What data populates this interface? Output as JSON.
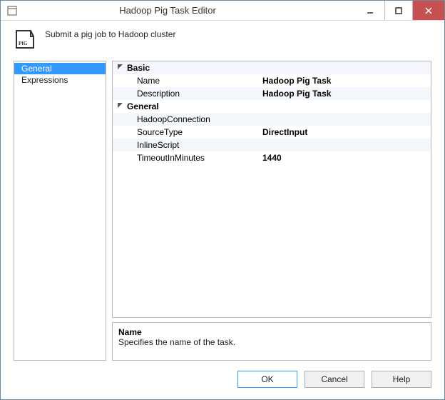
{
  "window": {
    "title": "Hadoop Pig Task Editor"
  },
  "header": {
    "subtitle": "Submit a pig job to Hadoop cluster",
    "pig_label": "PIG"
  },
  "sidebar": {
    "items": [
      {
        "label": "General",
        "selected": true
      },
      {
        "label": "Expressions",
        "selected": false
      }
    ]
  },
  "propgrid": {
    "categories": [
      {
        "name": "Basic",
        "rows": [
          {
            "label": "Name",
            "value": "Hadoop Pig Task"
          },
          {
            "label": "Description",
            "value": "Hadoop Pig Task"
          }
        ]
      },
      {
        "name": "General",
        "rows": [
          {
            "label": "HadoopConnection",
            "value": ""
          },
          {
            "label": "SourceType",
            "value": "DirectInput"
          },
          {
            "label": "InlineScript",
            "value": ""
          },
          {
            "label": "TimeoutInMinutes",
            "value": "1440"
          }
        ]
      }
    ]
  },
  "help": {
    "title": "Name",
    "desc": "Specifies the name of the task."
  },
  "buttons": {
    "ok": "OK",
    "cancel": "Cancel",
    "help": "Help"
  }
}
